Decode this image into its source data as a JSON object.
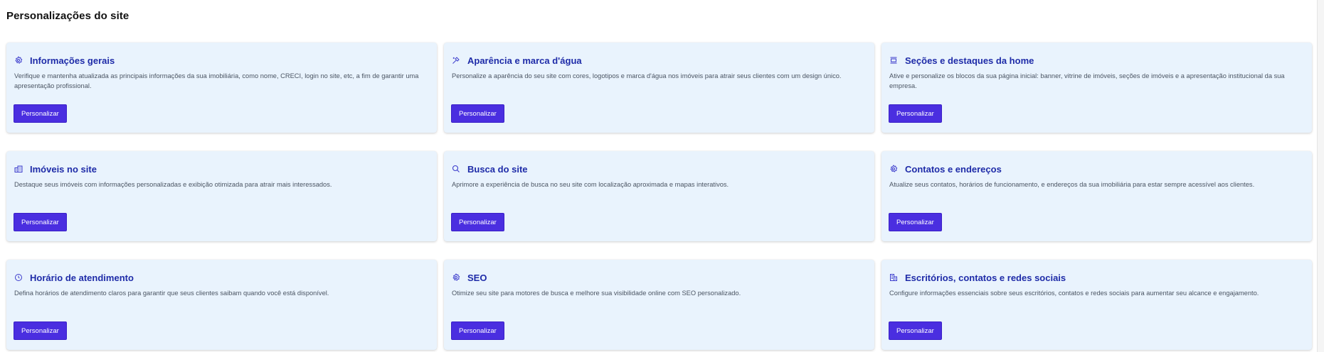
{
  "page": {
    "title": "Personalizações do site"
  },
  "button_label": "Personalizar",
  "cards": [
    {
      "icon": "gear-icon",
      "title": "Informações gerais",
      "description": "Verifique e mantenha atualizada as principais informações da sua imobiliária, como nome, CRECI, login no site, etc, a fim de garantir uma apresentação profissional."
    },
    {
      "icon": "brush-icon",
      "title": "Aparência e marca d'água",
      "description": "Personalize a aparência do seu site com cores, logotipos e marca d'água nos imóveis para atrair seus clientes com um design único."
    },
    {
      "icon": "layout-icon",
      "title": "Seções e destaques da home",
      "description": "Ative e personalize os blocos da sua página inicial: banner, vitrine de imóveis, seções de imóveis e a apresentação institucional da sua empresa."
    },
    {
      "icon": "buildings-icon",
      "title": "Imóveis no site",
      "description": "Destaque seus imóveis com informações personalizadas e exibição otimizada para atrair mais interessados."
    },
    {
      "icon": "search-icon",
      "title": "Busca do site",
      "description": "Aprimore a experiência de busca no seu site com localização aproximada e mapas interativos."
    },
    {
      "icon": "gear-icon",
      "title": "Contatos e endereços",
      "description": "Atualize seus contatos, horários de funcionamento, e endereços da sua imobiliária para estar sempre acessível aos clientes."
    },
    {
      "icon": "clock-icon",
      "title": "Horário de atendimento",
      "description": "Defina horários de atendimento claros para garantir que seus clientes saibam quando você está disponível."
    },
    {
      "icon": "gear-icon",
      "title": "SEO",
      "description": "Otimize seu site para motores de busca e melhore sua visibilidade online com SEO personalizado."
    },
    {
      "icon": "office-icon",
      "title": "Escritórios, contatos e redes sociais",
      "description": "Configure informações essenciais sobre seus escritórios, contatos e redes sociais para aumentar seu alcance e engajamento."
    }
  ]
}
